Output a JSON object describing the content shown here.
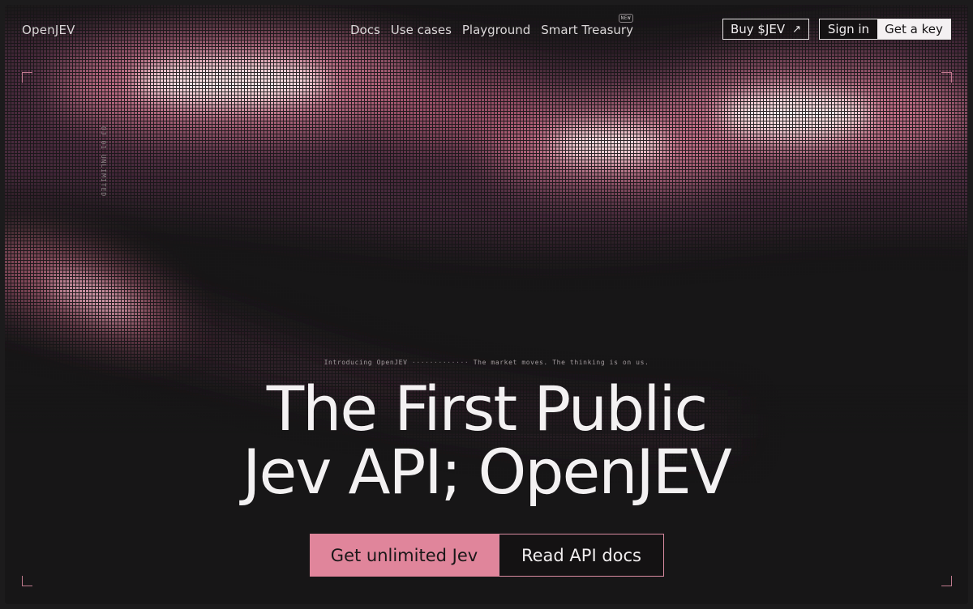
{
  "brand": "OpenJEV",
  "nav": [
    {
      "label": "Docs"
    },
    {
      "label": "Use cases"
    },
    {
      "label": "Playground"
    },
    {
      "label": "Smart Treasury",
      "badge": "NEW"
    }
  ],
  "actions": {
    "buy_label": "Buy $JEV",
    "buy_icon": "arrow-up-right-icon",
    "signin_label": "Sign in",
    "getkey_label": "Get a key"
  },
  "side_tag": "OJ 01 UNLIMITED",
  "hero": {
    "eyebrow_left": "Introducing OpenJEV",
    "eyebrow_dots": "·············",
    "eyebrow_right": "The market moves. The thinking is on us.",
    "headline_line1": "The First Public",
    "headline_line2": "Jev API; OpenJEV",
    "cta_primary": "Get unlimited Jev",
    "cta_secondary": "Read API docs"
  },
  "colors": {
    "accent_pink": "#e0859b",
    "background": "#171617",
    "glow_light": "#fbe1e3"
  }
}
